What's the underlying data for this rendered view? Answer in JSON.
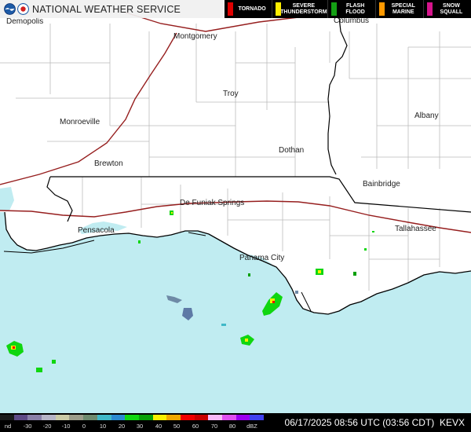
{
  "header": {
    "agency": "NATIONAL WEATHER SERVICE",
    "legend": [
      {
        "label": "TORNADO",
        "color": "#e00000"
      },
      {
        "label": "SEVERE\nTHUNDERSTORM",
        "color": "#ffee00"
      },
      {
        "label": "FLASH\nFLOOD",
        "color": "#14a014"
      },
      {
        "label": "SPECIAL\nMARINE",
        "color": "#ff9900"
      },
      {
        "label": "SNOW\nSQUALL",
        "color": "#d6148c"
      }
    ]
  },
  "cities": [
    {
      "name": "Demopolis"
    },
    {
      "name": "Montgomery"
    },
    {
      "name": "Columbus"
    },
    {
      "name": "Troy"
    },
    {
      "name": "Albany"
    },
    {
      "name": "Monroeville"
    },
    {
      "name": "Dothan"
    },
    {
      "name": "Brewton"
    },
    {
      "name": "Bainbridge"
    },
    {
      "name": "De Funiak Springs"
    },
    {
      "name": "Pensacola"
    },
    {
      "name": "Tallahassee"
    },
    {
      "name": "Panama City"
    }
  ],
  "colorbar": {
    "nd_label": "nd",
    "ticks": [
      "-30",
      "-20",
      "-10",
      "0",
      "10",
      "20",
      "30",
      "40",
      "50",
      "60",
      "70",
      "80"
    ],
    "unit": "dBZ",
    "colors": [
      "#1a1a1a",
      "#5e4a86",
      "#8a80a8",
      "#b6b4c6",
      "#cacaa6",
      "#9c9c8a",
      "#6e8a6e",
      "#3fb8c8",
      "#2a8ad0",
      "#10d610",
      "#08a008",
      "#f8f000",
      "#f0a800",
      "#f00000",
      "#c80000",
      "#f8b8f8",
      "#e050f0",
      "#9c00f0",
      "#4040f0"
    ]
  },
  "footer": {
    "timestamp": "06/17/2025 08:56 UTC (03:56 CDT)",
    "station": "KEVX"
  },
  "map": {
    "water_color": "#c0ecf1",
    "land_color": "#ffffff",
    "highway_color": "#961e1e",
    "state_line_color": "#000000",
    "county_line_color": "#bbbbbb"
  }
}
